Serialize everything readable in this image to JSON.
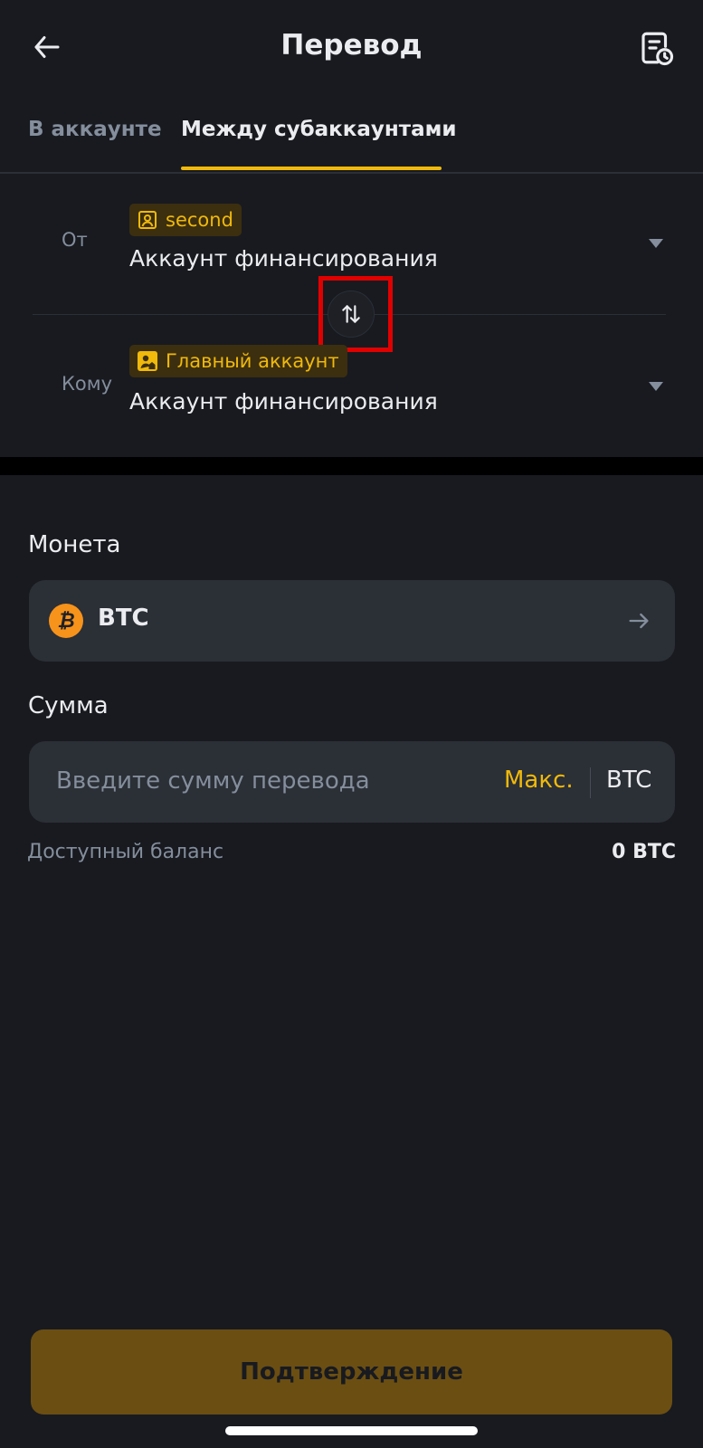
{
  "header": {
    "title": "Перевод"
  },
  "tabs": [
    {
      "label": "В аккаунте",
      "active": false
    },
    {
      "label": "Между субаккаунтами",
      "active": true
    }
  ],
  "from": {
    "label": "От",
    "badge": "second",
    "badge_icon": "user-icon",
    "account": "Аккаунт финансирования"
  },
  "to": {
    "label": "Кому",
    "badge": "Главный аккаунт",
    "badge_icon": "main-account-icon",
    "account": "Аккаунт финансирования"
  },
  "coin": {
    "section_title": "Монета",
    "name": "BTC",
    "icon": "bitcoin-icon"
  },
  "amount": {
    "section_title": "Сумма",
    "placeholder": "Введите сумму перевода",
    "max_label": "Макс.",
    "unit": "BTC"
  },
  "balance": {
    "label": "Доступный баланс",
    "value": "0 BTC"
  },
  "confirm": {
    "label": "Подтверждение"
  },
  "colors": {
    "background": "#181a20",
    "accent": "#f0b90b",
    "highlight": "#e00000",
    "confirm_disabled": "#6b4e12"
  }
}
